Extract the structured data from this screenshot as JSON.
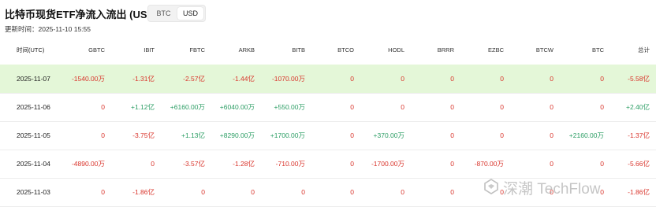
{
  "header": {
    "title": "比特币现货ETF净流入流出 (USD)",
    "currency_toggle": {
      "options": [
        "BTC",
        "USD"
      ],
      "selected": "USD"
    },
    "update_time": "更新时间：2025-11-10 15:55"
  },
  "table": {
    "columns": [
      "时间(UTC)",
      "GBTC",
      "IBIT",
      "FBTC",
      "ARKB",
      "BITB",
      "BTCO",
      "HODL",
      "BRRR",
      "EZBC",
      "BTCW",
      "BTC",
      "总计"
    ],
    "rows": [
      {
        "highlight": true,
        "cells": [
          "2025-11-07",
          "-1540.00万",
          "-1.31亿",
          "-2.57亿",
          "-1.44亿",
          "-1070.00万",
          "0",
          "0",
          "0",
          "0",
          "0",
          "0",
          "-5.58亿"
        ]
      },
      {
        "highlight": false,
        "cells": [
          "2025-11-06",
          "0",
          "+1.12亿",
          "+6160.00万",
          "+6040.00万",
          "+550.00万",
          "0",
          "0",
          "0",
          "0",
          "0",
          "0",
          "+2.40亿"
        ]
      },
      {
        "highlight": false,
        "cells": [
          "2025-11-05",
          "0",
          "-3.75亿",
          "+1.13亿",
          "+8290.00万",
          "+1700.00万",
          "0",
          "+370.00万",
          "0",
          "0",
          "0",
          "+2160.00万",
          "-1.37亿"
        ]
      },
      {
        "highlight": false,
        "cells": [
          "2025-11-04",
          "-4890.00万",
          "0",
          "-3.57亿",
          "-1.28亿",
          "-710.00万",
          "0",
          "-1700.00万",
          "0",
          "-870.00万",
          "0",
          "0",
          "-5.66亿"
        ]
      },
      {
        "highlight": false,
        "cells": [
          "2025-11-03",
          "0",
          "-1.86亿",
          "0",
          "0",
          "0",
          "0",
          "0",
          "0",
          "0",
          "0",
          "0",
          "-1.86亿"
        ]
      }
    ]
  },
  "watermark": {
    "text": "深潮 TechFlow",
    "icon": "techflow-logo-icon"
  },
  "colors": {
    "positive": "#2a9d63",
    "negative": "#d9342b",
    "highlight_row": "#e4f7d8"
  }
}
